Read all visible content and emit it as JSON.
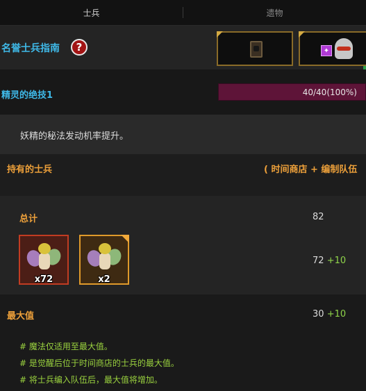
{
  "tabs": {
    "soldiers": "士兵",
    "relics": "遗物"
  },
  "guide": {
    "title": "名誉士兵指南",
    "help": "?"
  },
  "skill": {
    "name": "精灵的绝技1",
    "progress_text": "40/40(100%)",
    "progress_fraction": 1.0
  },
  "description": "妖精的秘法发动机率提升。",
  "owned": {
    "title": "持有的士兵",
    "source_note": "( 时间商店 + 编制队伍"
  },
  "total": {
    "label": "总计",
    "value": "82"
  },
  "units": [
    {
      "count": "x72"
    },
    {
      "count": "x2"
    }
  ],
  "combined": {
    "value": "72",
    "bonus": "+10"
  },
  "max": {
    "label": "最大值",
    "value": "30",
    "bonus": "+10"
  },
  "notes": [
    "# 魔法仅适用至最大值。",
    "# 是觉醒后位于时间商店的士兵的最大值。",
    "# 将士兵编入队伍后，最大值将增加。"
  ],
  "colors": {
    "accent_blue": "#3fb9e8",
    "accent_orange": "#eda03a",
    "note_green": "#9bd33f",
    "bonus_green": "#8fd44a"
  }
}
